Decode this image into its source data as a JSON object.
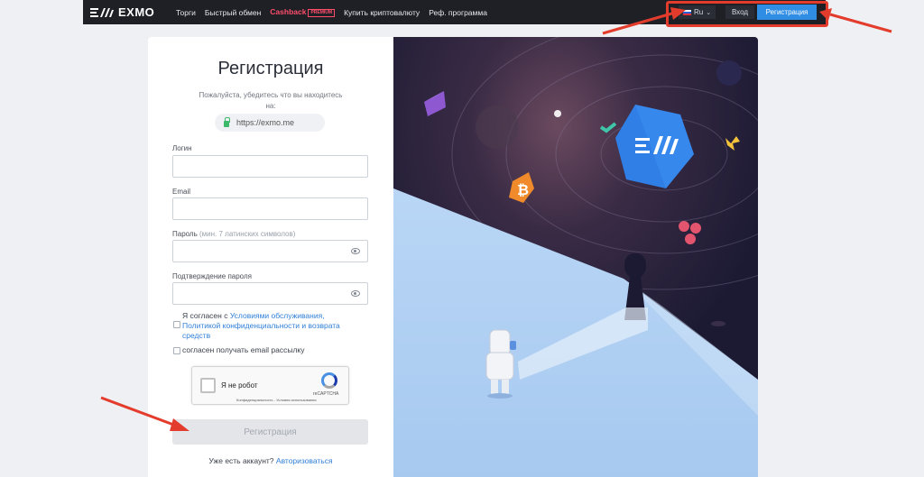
{
  "header": {
    "logo_text": "EXMO",
    "nav": [
      "Торги",
      "Быстрый обмен",
      "Cashback",
      "Купить криптовалюту",
      "Реф. программа"
    ],
    "premium_badge": "PREMIUM",
    "lang": "Ru",
    "login_label": "Вход",
    "register_label": "Регистрация"
  },
  "form": {
    "title": "Регистрация",
    "check_text": "Пожалуйста, убедитесь что вы находитесь на:",
    "url": "https://exmo.me",
    "login_label": "Логин",
    "email_label": "Email",
    "password_label": "Пароль",
    "password_hint": "(мин. 7 латинских символов)",
    "confirm_label": "Подтверждение пароля",
    "agree_prefix": "Я согласен с",
    "agree_link": "Условиями обслуживания, Политикой конфиденциальности и возврата средств",
    "newsletter": "согласен получать email рассылку",
    "captcha_label": "Я не робот",
    "captcha_brand": "reCAPTCHA",
    "captcha_terms": "Конфиденциальность - Условия использования",
    "submit_label": "Регистрация",
    "have_account": "Уже есть аккаунт?",
    "authorize_link": "Авторизоваться"
  },
  "colors": {
    "accent": "#2f8de4",
    "annotation": "#e33c2c",
    "header_bg": "#1e2026"
  }
}
